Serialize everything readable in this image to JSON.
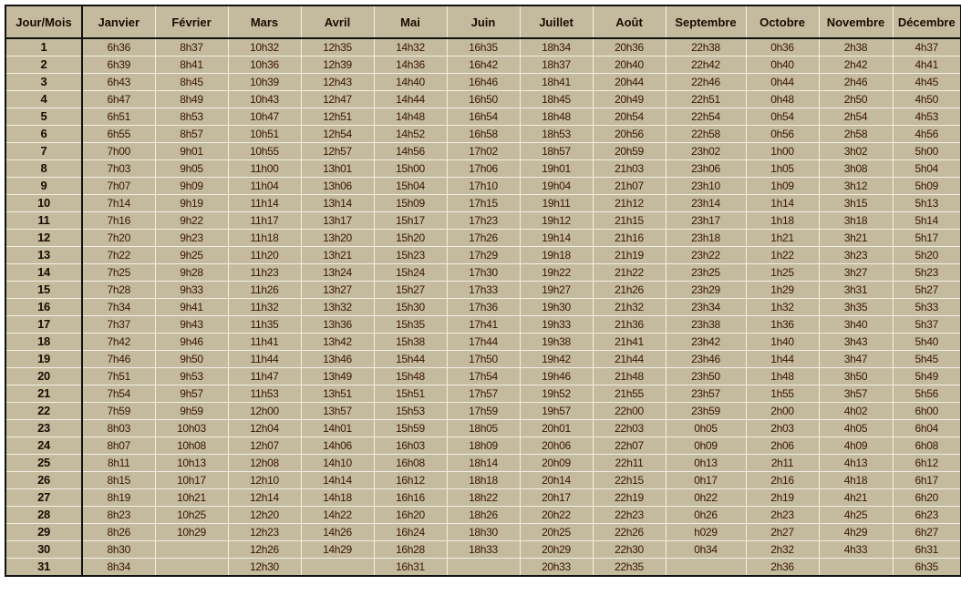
{
  "table": {
    "corner_label": "Jour/Mois",
    "months": [
      "Janvier",
      "Février",
      "Mars",
      "Avril",
      "Mai",
      "Juin",
      "Juillet",
      "Août",
      "Septembre",
      "Octobre",
      "Novembre",
      "Décembre"
    ],
    "rows": [
      {
        "day": "1",
        "times": [
          "6h36",
          "8h37",
          "10h32",
          "12h35",
          "14h32",
          "16h35",
          "18h34",
          "20h36",
          "22h38",
          "0h36",
          "2h38",
          "4h37"
        ]
      },
      {
        "day": "2",
        "times": [
          "6h39",
          "8h41",
          "10h36",
          "12h39",
          "14h36",
          "16h42",
          "18h37",
          "20h40",
          "22h42",
          "0h40",
          "2h42",
          "4h41"
        ]
      },
      {
        "day": "3",
        "times": [
          "6h43",
          "8h45",
          "10h39",
          "12h43",
          "14h40",
          "16h46",
          "18h41",
          "20h44",
          "22h46",
          "0h44",
          "2h46",
          "4h45"
        ]
      },
      {
        "day": "4",
        "times": [
          "6h47",
          "8h49",
          "10h43",
          "12h47",
          "14h44",
          "16h50",
          "18h45",
          "20h49",
          "22h51",
          "0h48",
          "2h50",
          "4h50"
        ]
      },
      {
        "day": "5",
        "times": [
          "6h51",
          "8h53",
          "10h47",
          "12h51",
          "14h48",
          "16h54",
          "18h48",
          "20h54",
          "22h54",
          "0h54",
          "2h54",
          "4h53"
        ]
      },
      {
        "day": "6",
        "times": [
          "6h55",
          "8h57",
          "10h51",
          "12h54",
          "14h52",
          "16h58",
          "18h53",
          "20h56",
          "22h58",
          "0h56",
          "2h58",
          "4h56"
        ]
      },
      {
        "day": "7",
        "times": [
          "7h00",
          "9h01",
          "10h55",
          "12h57",
          "14h56",
          "17h02",
          "18h57",
          "20h59",
          "23h02",
          "1h00",
          "3h02",
          "5h00"
        ]
      },
      {
        "day": "8",
        "times": [
          "7h03",
          "9h05",
          "11h00",
          "13h01",
          "15h00",
          "17h06",
          "19h01",
          "21h03",
          "23h06",
          "1h05",
          "3h08",
          "5h04"
        ]
      },
      {
        "day": "9",
        "times": [
          "7h07",
          "9h09",
          "11h04",
          "13h06",
          "15h04",
          "17h10",
          "19h04",
          "21h07",
          "23h10",
          "1h09",
          "3h12",
          "5h09"
        ]
      },
      {
        "day": "10",
        "times": [
          "7h14",
          "9h19",
          "11h14",
          "13h14",
          "15h09",
          "17h15",
          "19h11",
          "21h12",
          "23h14",
          "1h14",
          "3h15",
          "5h13"
        ]
      },
      {
        "day": "11",
        "times": [
          "7h16",
          "9h22",
          "11h17",
          "13h17",
          "15h17",
          "17h23",
          "19h12",
          "21h15",
          "23h17",
          "1h18",
          "3h18",
          "5h14"
        ]
      },
      {
        "day": "12",
        "times": [
          "7h20",
          "9h23",
          "11h18",
          "13h20",
          "15h20",
          "17h26",
          "19h14",
          "21h16",
          "23h18",
          "1h21",
          "3h21",
          "5h17"
        ]
      },
      {
        "day": "13",
        "times": [
          "7h22",
          "9h25",
          "11h20",
          "13h21",
          "15h23",
          "17h29",
          "19h18",
          "21h19",
          "23h22",
          "1h22",
          "3h23",
          "5h20"
        ]
      },
      {
        "day": "14",
        "times": [
          "7h25",
          "9h28",
          "11h23",
          "13h24",
          "15h24",
          "17h30",
          "19h22",
          "21h22",
          "23h25",
          "1h25",
          "3h27",
          "5h23"
        ]
      },
      {
        "day": "15",
        "times": [
          "7h28",
          "9h33",
          "11h26",
          "13h27",
          "15h27",
          "17h33",
          "19h27",
          "21h26",
          "23h29",
          "1h29",
          "3h31",
          "5h27"
        ]
      },
      {
        "day": "16",
        "times": [
          "7h34",
          "9h41",
          "11h32",
          "13h32",
          "15h30",
          "17h36",
          "19h30",
          "21h32",
          "23h34",
          "1h32",
          "3h35",
          "5h33"
        ]
      },
      {
        "day": "17",
        "times": [
          "7h37",
          "9h43",
          "11h35",
          "13h36",
          "15h35",
          "17h41",
          "19h33",
          "21h36",
          "23h38",
          "1h36",
          "3h40",
          "5h37"
        ]
      },
      {
        "day": "18",
        "times": [
          "7h42",
          "9h46",
          "11h41",
          "13h42",
          "15h38",
          "17h44",
          "19h38",
          "21h41",
          "23h42",
          "1h40",
          "3h43",
          "5h40"
        ]
      },
      {
        "day": "19",
        "times": [
          "7h46",
          "9h50",
          "11h44",
          "13h46",
          "15h44",
          "17h50",
          "19h42",
          "21h44",
          "23h46",
          "1h44",
          "3h47",
          "5h45"
        ]
      },
      {
        "day": "20",
        "times": [
          "7h51",
          "9h53",
          "11h47",
          "13h49",
          "15h48",
          "17h54",
          "19h46",
          "21h48",
          "23h50",
          "1h48",
          "3h50",
          "5h49"
        ]
      },
      {
        "day": "21",
        "times": [
          "7h54",
          "9h57",
          "11h53",
          "13h51",
          "15h51",
          "17h57",
          "19h52",
          "21h55",
          "23h57",
          "1h55",
          "3h57",
          "5h56"
        ]
      },
      {
        "day": "22",
        "times": [
          "7h59",
          "9h59",
          "12h00",
          "13h57",
          "15h53",
          "17h59",
          "19h57",
          "22h00",
          "23h59",
          "2h00",
          "4h02",
          "6h00"
        ]
      },
      {
        "day": "23",
        "times": [
          "8h03",
          "10h03",
          "12h04",
          "14h01",
          "15h59",
          "18h05",
          "20h01",
          "22h03",
          "0h05",
          "2h03",
          "4h05",
          "6h04"
        ]
      },
      {
        "day": "24",
        "times": [
          "8h07",
          "10h08",
          "12h07",
          "14h06",
          "16h03",
          "18h09",
          "20h06",
          "22h07",
          "0h09",
          "2h06",
          "4h09",
          "6h08"
        ]
      },
      {
        "day": "25",
        "times": [
          "8h11",
          "10h13",
          "12h08",
          "14h10",
          "16h08",
          "18h14",
          "20h09",
          "22h11",
          "0h13",
          "2h11",
          "4h13",
          "6h12"
        ]
      },
      {
        "day": "26",
        "times": [
          "8h15",
          "10h17",
          "12h10",
          "14h14",
          "16h12",
          "18h18",
          "20h14",
          "22h15",
          "0h17",
          "2h16",
          "4h18",
          "6h17"
        ]
      },
      {
        "day": "27",
        "times": [
          "8h19",
          "10h21",
          "12h14",
          "14h18",
          "16h16",
          "18h22",
          "20h17",
          "22h19",
          "0h22",
          "2h19",
          "4h21",
          "6h20"
        ]
      },
      {
        "day": "28",
        "times": [
          "8h23",
          "10h25",
          "12h20",
          "14h22",
          "16h20",
          "18h26",
          "20h22",
          "22h23",
          "0h26",
          "2h23",
          "4h25",
          "6h23"
        ]
      },
      {
        "day": "29",
        "times": [
          "8h26",
          "10h29",
          "12h23",
          "14h26",
          "16h24",
          "18h30",
          "20h25",
          "22h26",
          "h029",
          "2h27",
          "4h29",
          "6h27"
        ]
      },
      {
        "day": "30",
        "times": [
          "8h30",
          "",
          "12h26",
          "14h29",
          "16h28",
          "18h33",
          "20h29",
          "22h30",
          "0h34",
          "2h32",
          "4h33",
          "6h31"
        ]
      },
      {
        "day": "31",
        "times": [
          "8h34",
          "",
          "12h30",
          "",
          "16h31",
          "",
          "20h33",
          "22h35",
          "",
          "2h36",
          "",
          "6h35"
        ]
      }
    ]
  },
  "colors": {
    "cell_background": "#c4bb9f",
    "grid_lines": "#f3eee2",
    "text": "#3a1500",
    "outer_border": "#111111"
  }
}
